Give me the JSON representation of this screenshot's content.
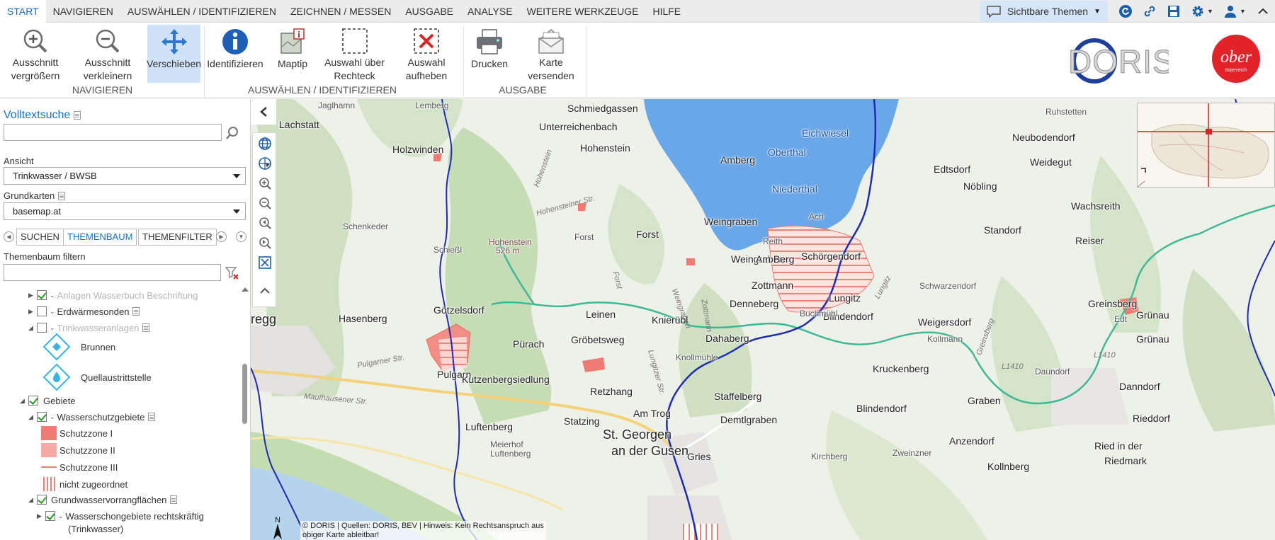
{
  "menu": {
    "tabs": [
      "START",
      "NAVIGIEREN",
      "AUSWÄHLEN / IDENTIFIZIEREN",
      "ZEICHNEN / MESSEN",
      "AUSGABE",
      "ANALYSE",
      "WEITERE WERKZEUGE",
      "HILFE"
    ],
    "visible_themes": "Sichtbare Themen"
  },
  "ribbon": {
    "zoom_in": "Ausschnitt\nvergrößern",
    "zoom_out": "Ausschnitt\nverkleinern",
    "pan": "Verschieben",
    "identify": "Identifizieren",
    "maptip": "Maptip",
    "select_rect": "Auswahl über\nRechteck",
    "clear_selection": "Auswahl\naufheben",
    "print": "Drucken",
    "send_map": "Karte\nversenden",
    "group_nav": "NAVIGIEREN",
    "group_select": "AUSWÄHLEN / IDENTIFIZIEREN",
    "group_output": "AUSGABE",
    "logo_doris": "DORIS",
    "logo_ooe": "ober",
    "logo_ooe_sub": "österreich"
  },
  "sidebar": {
    "fulltext_title": "Volltextsuche",
    "view_label": "Ansicht",
    "view_value": "Trinkwasser / BWSB",
    "basemap_label": "Grundkarten",
    "basemap_value": "basemap.at",
    "tabs": [
      "SUCHEN",
      "THEMENBAUM",
      "THEMENFILTER"
    ],
    "filter_label": "Themenbaum filtern",
    "tree": {
      "anlagen": "Anlagen Wasserbuch Beschriftung",
      "erdwaerme": "Erdwärmesonden",
      "trinkwasser": "Trinkwasseranlagen",
      "brunnen": "Brunnen",
      "quell": "Quellaustrittstelle",
      "gebiete": "Gebiete",
      "wsg": "Wasserschutzgebiete",
      "sz1": "Schutzzone I",
      "sz2": "Schutzzone II",
      "sz3": "Schutzzone III",
      "nz": "nicht zugeordnet",
      "gwv": "Grundwasservorrangflächen",
      "wsg_rk": "Wasserschongebiete rechtskräftig",
      "wsg_rk2": "(Trinkwasser)"
    }
  },
  "map": {
    "places": {
      "schmiedgassen": "Schmiedgassen",
      "eichwiesel": "Eichwiesel",
      "neubodendorf": "Neubodendorf",
      "weidegut": "Weidegut",
      "lachstatt": "Lachstatt",
      "unterreichenbach": "Unterreichenbach",
      "holzwinden": "Holzwinden",
      "hohenstein": "Hohenstein",
      "amberg": "Amberg",
      "oberthal": "Oberthal",
      "edtsdorf": "Edtsdorf",
      "noebling": "Nöbling",
      "niederthal": "Niederthal",
      "wachsreith": "Wachsreith",
      "standorf": "Standorf",
      "reiser": "Reiser",
      "forst": "Forst",
      "weingraben1": "Weingraben",
      "weingraben2": "Weingraben",
      "schoergendorf": "Schörgendorf",
      "am_berg": "Am Berg",
      "zottmann": "Zottmann",
      "lungitz": "Lungitz",
      "denneberg": "Denneberg",
      "greinsberg": "Greinsberg",
      "hasenberg": "Hasenberg",
      "goetzelsdorf": "Götzelsdorf",
      "leinen": "Leinen",
      "knieruebl": "Knierübl",
      "dahaberg": "Dahaberg",
      "blindendorf1": "Blindendorf",
      "weigersdorf": "Weigersdorf",
      "gruenau1": "Grünau",
      "gruenau2": "Grünau",
      "puerach": "Pürach",
      "groebetsweg": "Gröbetsweg",
      "kruckenberg": "Kruckenberg",
      "pulgarn": "Pulgarn",
      "kutzenbergsiedlung": "Kutzenbergsiedlung",
      "retzhang": "Retzhang",
      "staffelberg": "Staffelberg",
      "danndorf": "Danndorf",
      "am_trog": "Am Trog",
      "demtlgraben": "Demtlgraben",
      "blindendorf2": "Blindendorf",
      "graben": "Graben",
      "rieddorf": "Rieddorf",
      "luftenberg": "Luftenberg",
      "statzing": "Statzing",
      "st_georgen1": "St. Georgen",
      "st_georgen2": "an der Gusen",
      "anzendorf": "Anzendorf",
      "ried": "Ried in der",
      "riedmark": "Riedmark",
      "regg": "regg",
      "gries": "Gries",
      "kirchberg": "Kirchberg",
      "kollnberg": "Kollnberg",
      "ru": "Ru",
      "hohenstein_peak": "Hohenstein",
      "hohenstein_elev": "526 m",
      "schenkeder": "Schenkeder",
      "lemberg": "Lemberg",
      "schiessl": "Schießl",
      "ach": "Ach",
      "reith": "Reith",
      "schwarzendorf": "Schwarzendorf",
      "kollmann": "Kollmann",
      "edt": "Edt",
      "daundorf": "Daundorf",
      "zweinzner": "Zweinzner",
      "meierhof": "Meierhof",
      "meierhof2": "Luftenberg",
      "ruhstetten": "Ruhstetten",
      "jaglhamn": "Jaglhamn",
      "forst2": "Forst",
      "buchmuehl": "Buchmühl",
      "knollmuehle": "Knollmühle",
      "ltr1": "L1410",
      "ltr2": "L1410"
    },
    "roads": {
      "r1": "Hohenstein",
      "r2": "Hohensteiner Str.",
      "r3": "Forst",
      "r4": "Lungitz",
      "r5": "Pulgarner Str.",
      "r6": "Mauthausener Str.",
      "r7": "Zottmann",
      "r8": "Greinsberg",
      "r9": "Lungitzer Str.",
      "r10": "Weingraben"
    },
    "north_label": "N",
    "attribution": "© DORIS | Quellen: DORIS, BEV | Hinweis: Kein Rechtsanspruch aus\nobiger Karte ableitbar!"
  },
  "colors": {
    "accent": "#1a6fc0",
    "lake": "#5a9ee8",
    "zone_red": "#e8837a",
    "river": "#1f2bb4",
    "boundary": "#3fb896"
  }
}
